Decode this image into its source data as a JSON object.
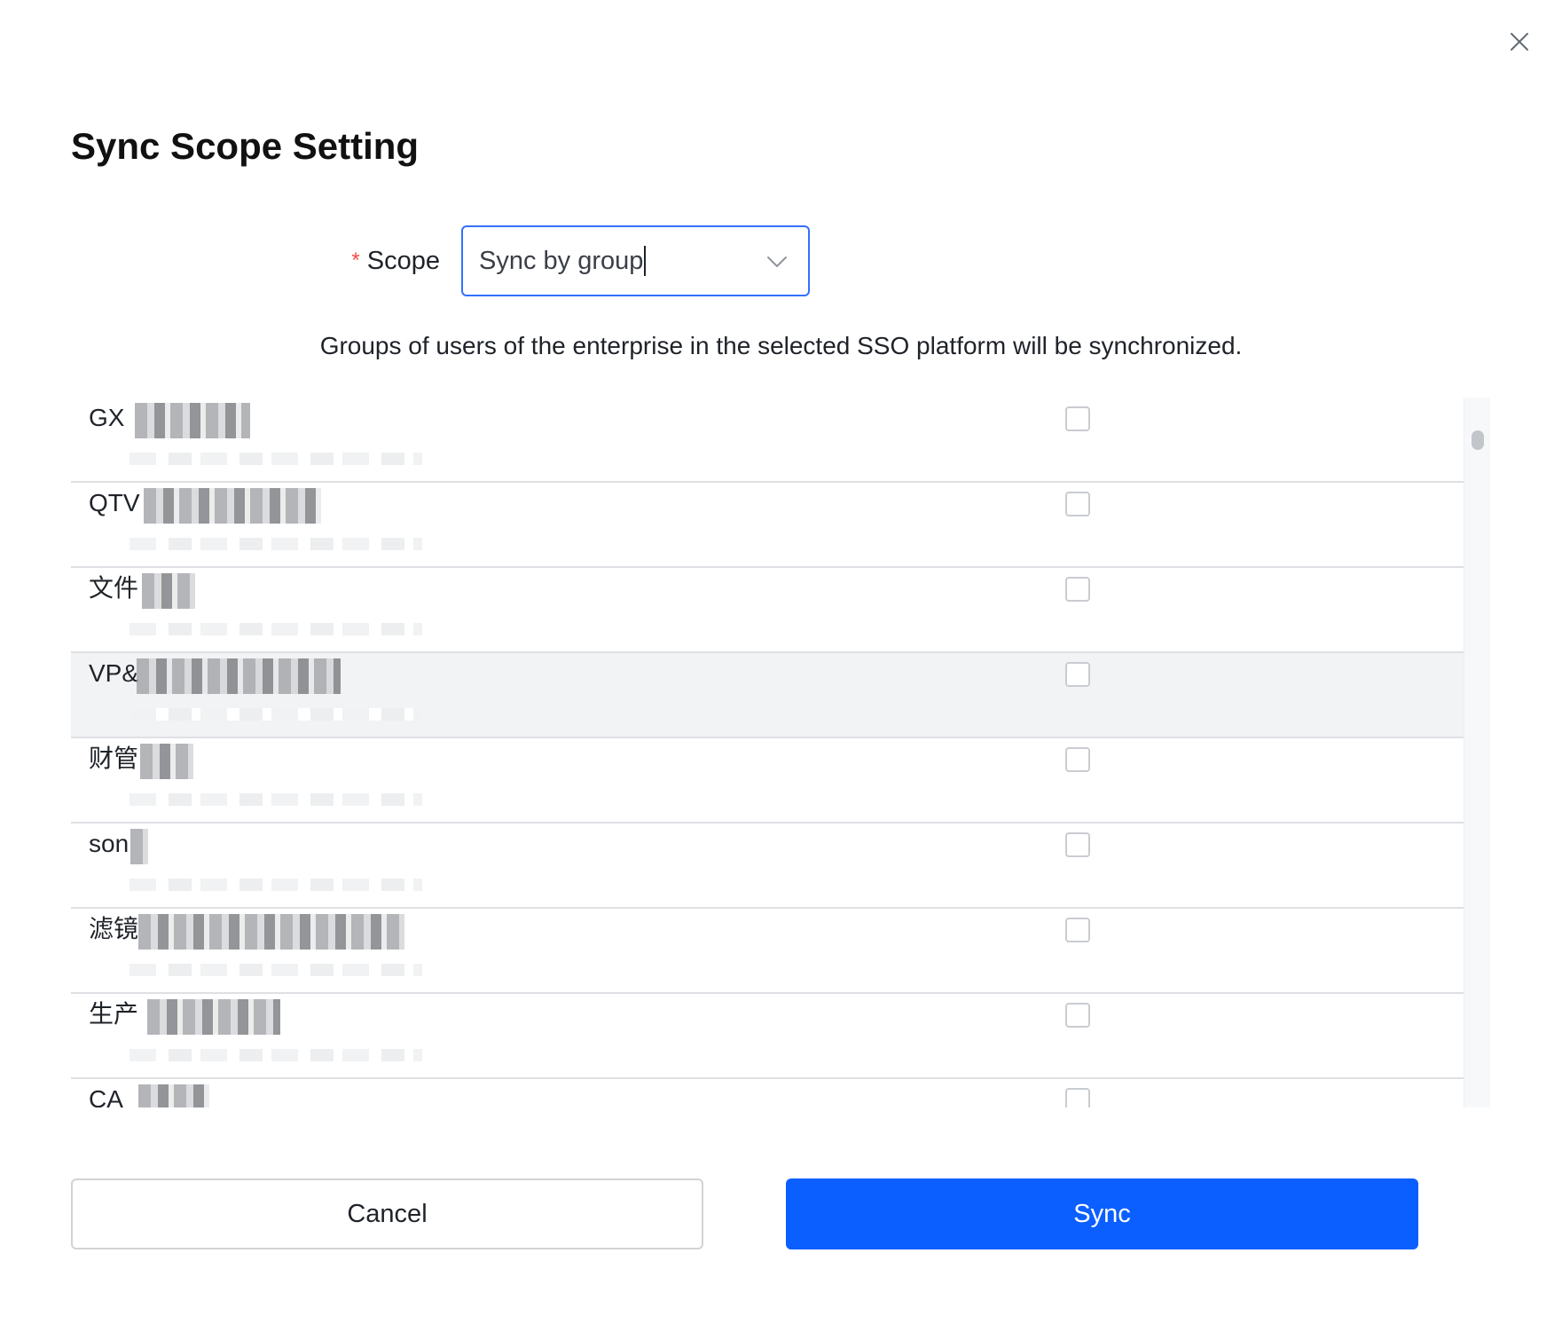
{
  "dialog": {
    "title": "Sync Scope Setting",
    "close_icon": "close-icon"
  },
  "scope": {
    "required_mark": "*",
    "label": "Scope",
    "value": "Sync by group",
    "chevron_icon": "chevron-down-icon"
  },
  "hint": "Groups of users of the enterprise in the selected SSO platform will be synchronized.",
  "groups": [
    {
      "name": "GX",
      "checked": false
    },
    {
      "name": "QTV",
      "checked": false
    },
    {
      "name": "文件",
      "checked": false
    },
    {
      "name": "VP&",
      "checked": false
    },
    {
      "name": "财管",
      "checked": false
    },
    {
      "name": "son",
      "checked": false
    },
    {
      "name": "滤镜",
      "checked": false
    },
    {
      "name": "生产",
      "checked": false
    },
    {
      "name": "CA",
      "checked": false
    }
  ],
  "footer": {
    "cancel_label": "Cancel",
    "sync_label": "Sync"
  },
  "colors": {
    "primary": "#0b5fff",
    "focus_border": "#3370ff",
    "required": "#f54a45",
    "row_hover": "#f2f3f5",
    "divider": "#dee0e3"
  }
}
